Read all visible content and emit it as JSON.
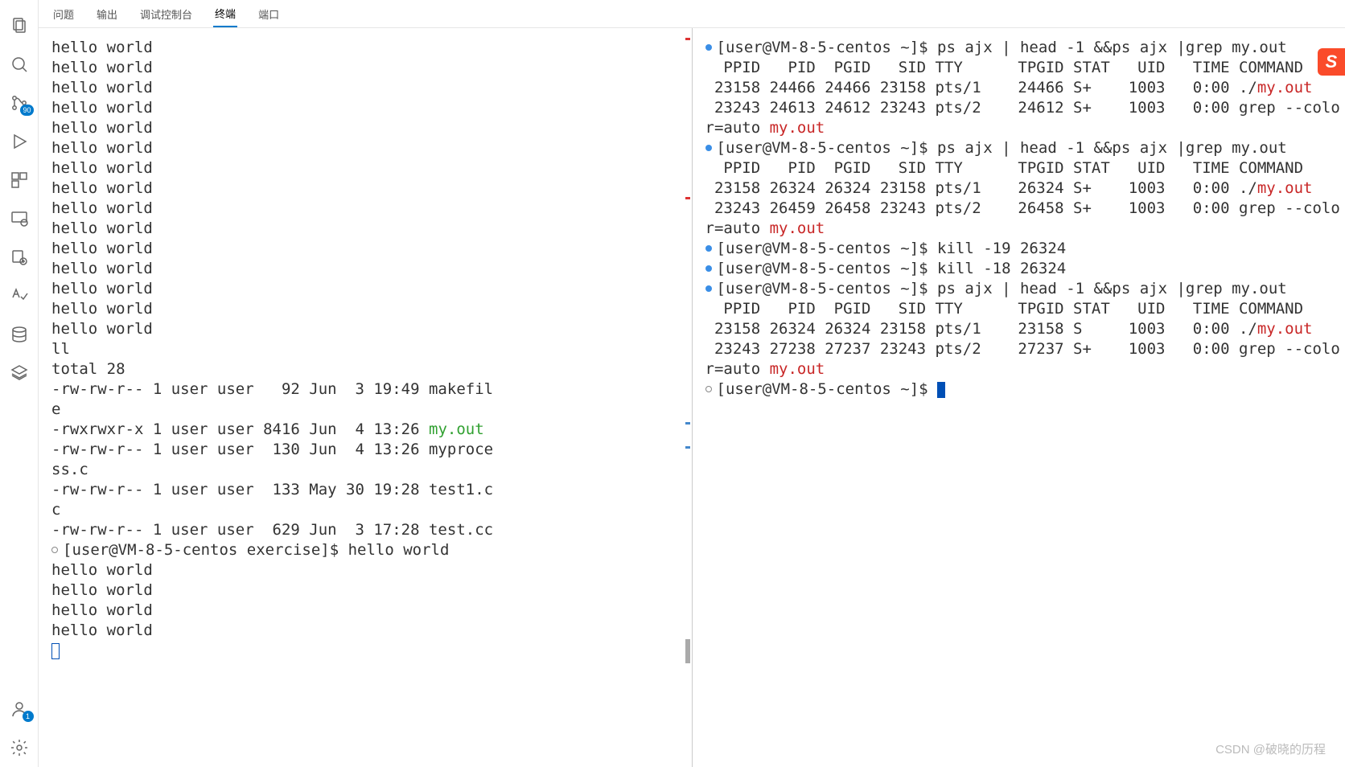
{
  "tabs": {
    "problems": "问题",
    "output": "输出",
    "debugConsole": "调试控制台",
    "terminal": "终端",
    "ports": "端口"
  },
  "activity": {
    "badge90": "90",
    "badge1": "1"
  },
  "sogou": "S",
  "watermark": "CSDN @破晓的历程",
  "left": {
    "helloRepeat": "hello world",
    "ll": "ll",
    "total": "total 28",
    "ls1a": "-rw-rw-r-- 1 user user   92 Jun  3 19:49 makefil",
    "ls1b": "e",
    "ls2a": "-rwxrwxr-x 1 user user 8416 Jun  4 13:26 ",
    "ls2b": "my.out",
    "ls3a": "-rw-rw-r-- 1 user user  130 Jun  4 13:26 myproce",
    "ls3b": "ss.c",
    "ls4a": "-rw-rw-r-- 1 user user  133 May 30 19:28 test1.c",
    "ls4b": "c",
    "ls5": "-rw-rw-r-- 1 user user  629 Jun  3 17:28 test.cc",
    "prompt": "[user@VM-8-5-centos exercise]$ hello world"
  },
  "right": {
    "prompt": "[user@VM-8-5-centos ~]$ ",
    "cmd_ps": "ps ajx | head -1 &&ps ajx |grep my.out",
    "hdr": "  PPID   PID  PGID   SID TTY      TPGID STAT   UID   TIME COMMAND",
    "b1r1a": " 23158 24466 24466 23158 pts/1    24466 S+    1003   0:00 ./",
    "b1r1b": "my.out",
    "b1r2a": " 23243 24613 24612 23243 pts/2    24612 S+    1003   0:00 grep --colo",
    "b1r2b": "r=auto ",
    "b1r2c": "my.out",
    "b2r1a": " 23158 26324 26324 23158 pts/1    26324 S+    1003   0:00 ./",
    "b2r1b": "my.out",
    "b2r2a": " 23243 26459 26458 23243 pts/2    26458 S+    1003   0:00 grep --colo",
    "b2r2b": "r=auto ",
    "b2r2c": "my.out",
    "cmd_kill19": "kill -19 26324",
    "cmd_kill18": "kill -18 26324",
    "b3r1a": " 23158 26324 26324 23158 pts/1    23158 S     1003   0:00 ./",
    "b3r1b": "my.out",
    "b3r2a": " 23243 27238 27237 23243 pts/2    27237 S+    1003   0:00 grep --colo",
    "b3r2b": "r=auto ",
    "b3r2c": "my.out"
  }
}
